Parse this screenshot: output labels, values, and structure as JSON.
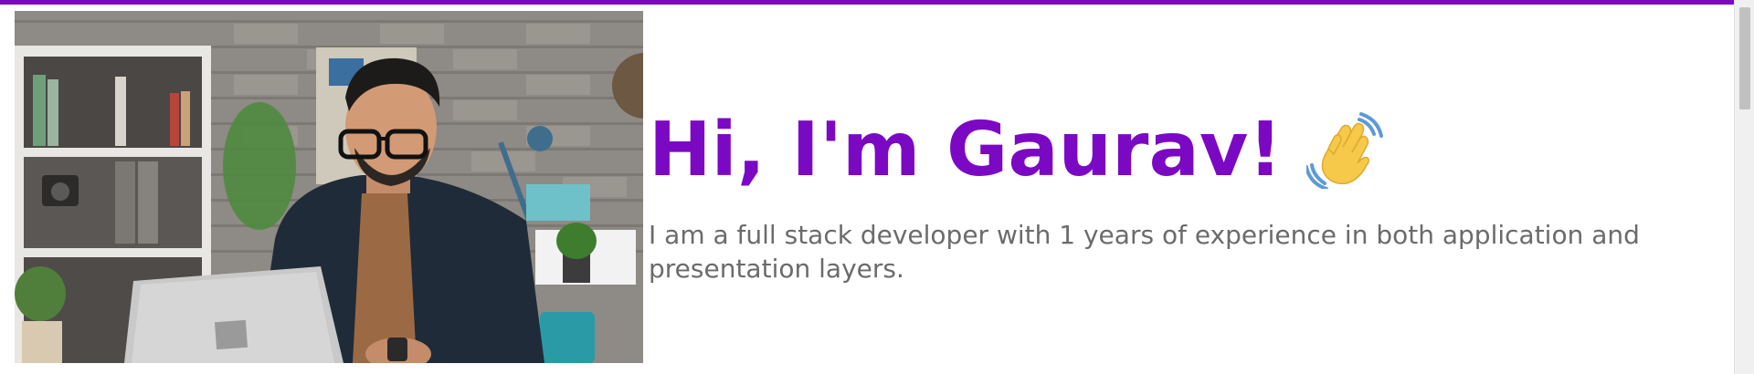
{
  "hero": {
    "title": "Hi, I'm Gaurav!",
    "wave_emoji": "waving-hand",
    "subtitle": "I am a full stack developer with 1 years of experience in both application and presentation layers.",
    "photo": "developer-at-laptop-photo"
  },
  "colors": {
    "accent": "#7b09c4",
    "subtitle": "#6b6b6b",
    "background": "#ffffff"
  }
}
